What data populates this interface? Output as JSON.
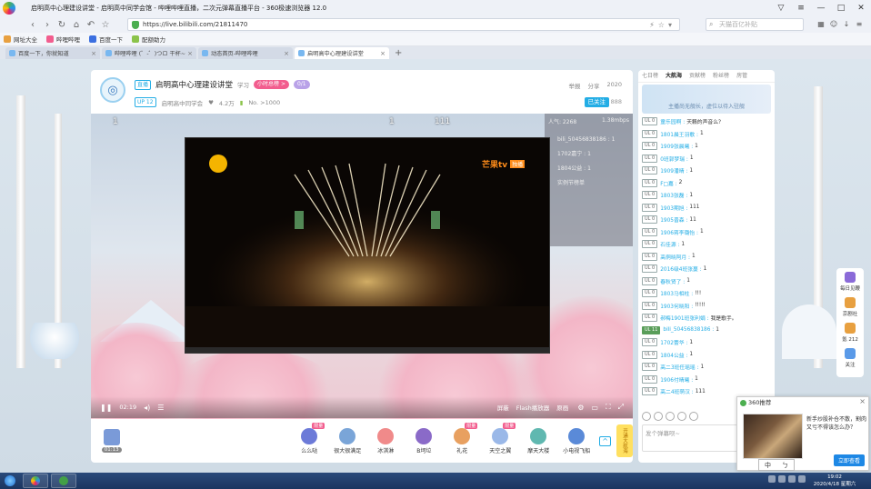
{
  "browser": {
    "title": "启明高中心理建设讲堂 - 启明高中同学会馆 - 哔哩哔哩直播，二次元弹幕直播平台 - 360极速浏览器 12.0",
    "url": "https://live.bilibili.com/21811470",
    "search_placeholder": "天猫百亿补贴",
    "bookmarks": [
      "网址大全",
      "哔哩哔哩",
      "百度一下",
      "配额助力"
    ],
    "tabs": [
      "百度一下，你就知道",
      "哔哩哔哩 (゜-゜)つロ 干杯~",
      "动态首页-哔哩哔哩",
      "启明高中心理建设讲堂"
    ]
  },
  "room": {
    "live_tag": "直播",
    "title": "启明高中心理建设讲堂",
    "category": "学习",
    "rank_badge": "小时总榜 >",
    "guard_badge": "0/1",
    "up_level": "UP 12",
    "streamer": "启明高中同学会",
    "fans": "4.2万",
    "rank": "No. >1000",
    "actions": [
      "举报",
      "分享",
      "2020"
    ],
    "follow_label": "已关注",
    "follow_count": "888"
  },
  "player": {
    "overlay_numbers": [
      "1",
      "1",
      "111"
    ],
    "video_logo": "芒果tv",
    "video_logo_badge": "独播",
    "stats": {
      "popularity": "人气: 2268",
      "bitrate": "1.38mbps",
      "lines": [
        "bili_50456838186 : 1",
        "1702嘉宁 : 1",
        "1804公益 : 1",
        "实例节榜单"
      ]
    },
    "time": "02:19",
    "controls": [
      "屏蔽",
      "Flash播放器",
      "原画"
    ]
  },
  "gifts": {
    "live_time": "01:13",
    "items": [
      {
        "name": "么么哒",
        "badge": "限量",
        "color": "#6c7ad8"
      },
      {
        "name": "很大很满足",
        "badge": "",
        "color": "#7aa5d8"
      },
      {
        "name": "冰淇淋",
        "badge": "",
        "color": "#f08a8a"
      },
      {
        "name": "B坷垃",
        "badge": "",
        "color": "#8a6ac8"
      },
      {
        "name": "礼花",
        "badge": "限量",
        "color": "#e8a060"
      },
      {
        "name": "天空之翼",
        "badge": "限量",
        "color": "#9ab8e8"
      },
      {
        "name": "摩天大楼",
        "badge": "",
        "color": "#60b8b0"
      },
      {
        "name": "小电视飞船",
        "badge": "",
        "color": "#5a8ad8"
      }
    ],
    "promo": "开通大航海"
  },
  "chat": {
    "tabs": [
      "七日榜",
      "大航海",
      "贡献榜",
      "粉丝榜",
      "房管"
    ],
    "banner": "主播尚无舰长，虚位以待入驻舰",
    "messages": [
      {
        "level": "UL 0",
        "user": "童乐园啊 :",
        "text": "天籁的声音么？"
      },
      {
        "level": "UL 0",
        "user": "1801晨王羽歌 :",
        "text": "1"
      },
      {
        "level": "UL 0",
        "user": "1909张晨曦 :",
        "text": "1"
      },
      {
        "level": "UL 0",
        "user": "0班郭梦瑞 :",
        "text": "1"
      },
      {
        "level": "UL 0",
        "user": "1909潘晴 :",
        "text": "1"
      },
      {
        "level": "UL 0",
        "user": "F□嘉 :",
        "text": "2"
      },
      {
        "level": "UL 0",
        "user": "1803张磊 :",
        "text": "1"
      },
      {
        "level": "UL 0",
        "user": "1903期旭 :",
        "text": "111"
      },
      {
        "level": "UL 0",
        "user": "1905晋森 :",
        "text": "11"
      },
      {
        "level": "UL 0",
        "user": "1906蒋李璐怡 :",
        "text": "1"
      },
      {
        "level": "UL 0",
        "user": "石佳源 :",
        "text": "1"
      },
      {
        "level": "UL 0",
        "user": "高侗晓阿月 :",
        "text": "1"
      },
      {
        "level": "UL 0",
        "user": "2016级4班张蔓 :",
        "text": "1"
      },
      {
        "level": "UL 0",
        "user": "春秋贤了 :",
        "text": "1"
      },
      {
        "level": "UL 0",
        "user": "1803马相柱 :",
        "text": "!!!"
      },
      {
        "level": "UL 0",
        "user": "1903何晓阳 :",
        "text": "!!!!!"
      },
      {
        "level": "UL 0",
        "user": "郝梅1901班张利娟 :",
        "text": "我是歌手。"
      },
      {
        "level": "UL 11",
        "user": "bili_50456838186 :",
        "text": "1"
      },
      {
        "level": "UL 0",
        "user": "1702蕾华 :",
        "text": "1"
      },
      {
        "level": "UL 0",
        "user": "1804公益 :",
        "text": "1"
      },
      {
        "level": "UL 0",
        "user": "高二3班任瑶瑶 :",
        "text": "1"
      },
      {
        "level": "UL 0",
        "user": "1906付晴曦 :",
        "text": "1"
      },
      {
        "level": "UL 0",
        "user": "高二4班萌汉 :",
        "text": "111"
      }
    ],
    "input_placeholder": "发个弹幕呗~"
  },
  "sidebar": [
    {
      "label": "每日见鞭",
      "color": "#8a6ad8"
    },
    {
      "label": "京剧社",
      "color": "#e8a040"
    },
    {
      "label": "氪 212",
      "color": "#e8a040"
    },
    {
      "label": "关注",
      "color": "#5a9ae8"
    }
  ],
  "popup": {
    "title": "360推荐",
    "text": "新手炒股补仓不散，割肉又亏不得该怎么办？",
    "button": "立即查看"
  },
  "ime": [
    "中",
    "ㄅ"
  ],
  "clock": {
    "time": "19:02",
    "date": "2020/4/18 星期六"
  }
}
